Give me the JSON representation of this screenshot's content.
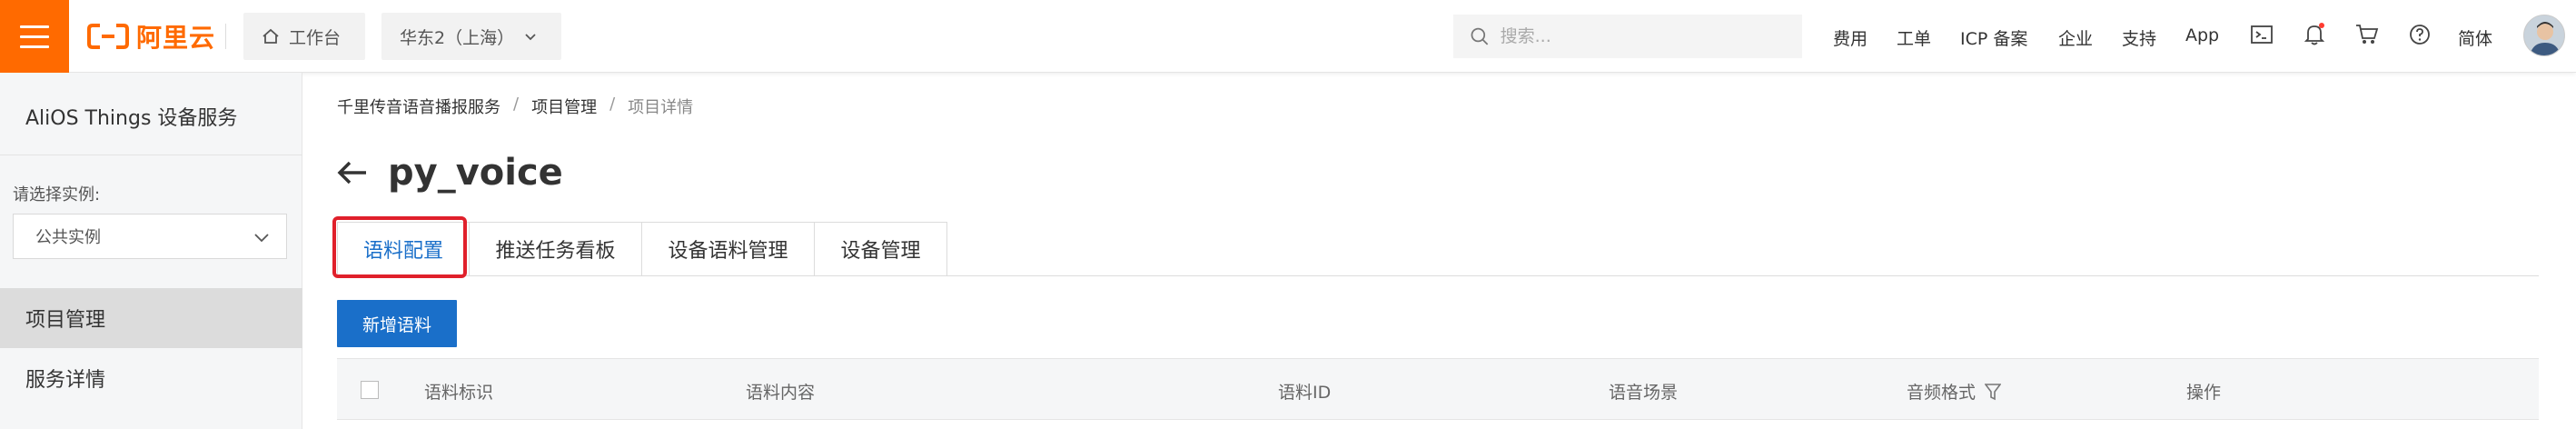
{
  "topbar": {
    "logo_text": "阿里云",
    "workbench_label": "工作台",
    "region_label": "华东2（上海）",
    "search_placeholder": "搜索...",
    "nav": {
      "fees": "费用",
      "tickets": "工单",
      "icp": "ICP 备案",
      "enterprise": "企业",
      "support": "支持",
      "app": "App",
      "language": "简体"
    },
    "brand_color": "#ff6a00"
  },
  "sidebar": {
    "title": "AliOS Things 设备服务",
    "instance_label": "请选择实例:",
    "instance_value": "公共实例",
    "items": [
      {
        "label": "项目管理",
        "active": true
      },
      {
        "label": "服务详情",
        "active": false
      }
    ]
  },
  "breadcrumb": {
    "items": [
      "千里传音语音播报服务",
      "项目管理",
      "项目详情"
    ],
    "separator": "/"
  },
  "page": {
    "title": "py_voice"
  },
  "tabs": [
    {
      "label": "语料配置",
      "active": true
    },
    {
      "label": "推送任务看板",
      "active": false
    },
    {
      "label": "设备语料管理",
      "active": false
    },
    {
      "label": "设备管理",
      "active": false
    }
  ],
  "actions": {
    "add_label": "新增语料"
  },
  "table": {
    "columns": [
      "语料标识",
      "语料内容",
      "语料ID",
      "语音场景",
      "音频格式",
      "操作"
    ]
  },
  "colors": {
    "accent_blue": "#1a6fc9",
    "highlight_red": "#e0202b"
  }
}
